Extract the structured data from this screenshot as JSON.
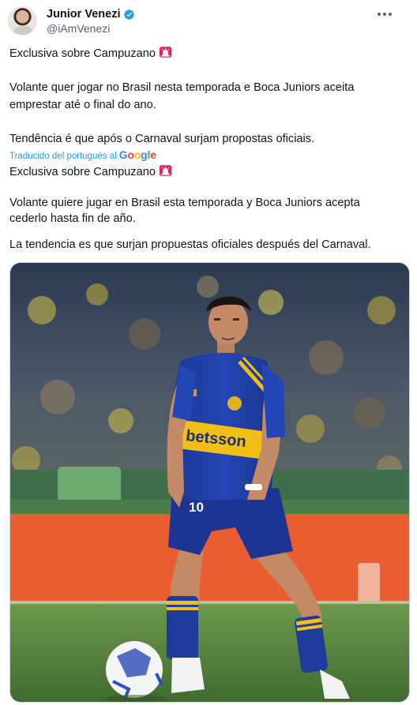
{
  "author": {
    "display_name": "Junior Venezi",
    "handle": "@iAmVenezi"
  },
  "tweet": {
    "original": {
      "line1": "Exclusiva sobre Campuzano",
      "line2a": "Volante quer jogar no Brasil nesta temporada e Boca Juniors aceita",
      "line2b": "emprestar até o final do ano.",
      "line3": "Tendência é que após o Carnaval surjam propostas oficiais."
    },
    "translation_label": "Traducido del portugués al",
    "translation_provider": "Google",
    "translated": {
      "line1": "Exclusiva sobre Campuzano",
      "line2a": "Volante quiere jugar en Brasil esta temporada y Boca Juniors acepta",
      "line2b": "cederlo hasta fin de año.",
      "line3": "La tendencia es que surjan propuestas oficiales después del Carnaval."
    }
  },
  "media": {
    "sponsor_text": "betsson",
    "shirt_number": "10"
  },
  "colors": {
    "link_blue": "#1d9bf0",
    "text_primary": "#0f1419",
    "text_secondary": "#536471",
    "boca_blue": "#1f3fa8",
    "boca_gold": "#f2c014",
    "siren_red": "#e0245e"
  },
  "icons": {
    "verified": "verified-badge-icon",
    "siren": "police-light-emoji",
    "more": "more-options-icon"
  }
}
